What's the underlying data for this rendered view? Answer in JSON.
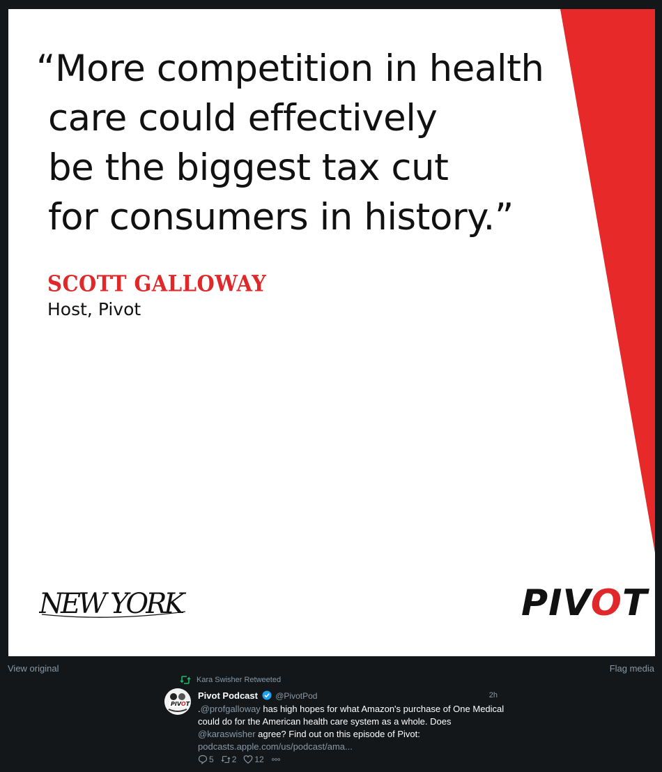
{
  "media": {
    "quote_lines": [
      "“More competition in health",
      "care could effectively",
      "be the biggest tax cut",
      "for consumers in history.”"
    ],
    "author": "SCOTT GALLOWAY",
    "role": "Host, Pivot",
    "publication_logo": "NEW YORK",
    "podcast_logo_prefix": "PIV",
    "podcast_logo_o": "O",
    "podcast_logo_suffix": "T",
    "accent_color": "#e0282a"
  },
  "controls": {
    "view_original": "View original",
    "flag_media": "Flag media"
  },
  "tweet": {
    "retweeted_by": "Kara Swisher Retweeted",
    "display_name": "Pivot Podcast",
    "handle": "@PivotPod",
    "time": "2h",
    "text_prefix": ".",
    "mention1": "@profgalloway",
    "text_middle": " has high hopes for what Amazon's purchase of One Medical could do for the American health care system as a whole. Does ",
    "mention2": "@karaswisher",
    "text_suffix": " agree? Find out on this episode of Pivot: ",
    "link": "podcasts.apple.com/us/podcast/ama...",
    "replies": "5",
    "retweets": "2",
    "likes": "12"
  }
}
